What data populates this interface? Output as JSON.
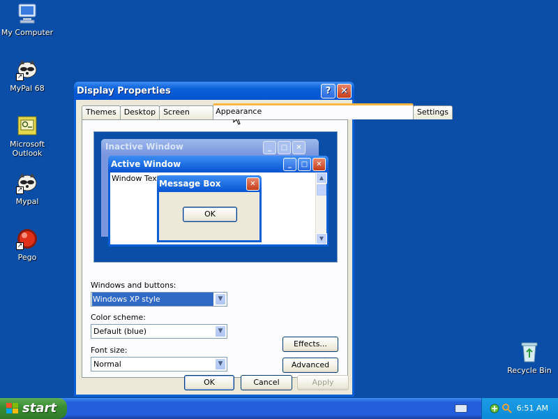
{
  "desktop": {
    "icons": [
      {
        "label": "My Computer"
      },
      {
        "label": "MyPal 68"
      },
      {
        "label": "Microsoft\nOutlook"
      },
      {
        "label": "Mypal"
      },
      {
        "label": "Pego"
      },
      {
        "label": "Recycle Bin"
      }
    ]
  },
  "dialog": {
    "title": "Display Properties",
    "help_glyph": "?",
    "close_glyph": "✕",
    "tabs": [
      "Themes",
      "Desktop",
      "Screen Saver",
      "Appearance",
      "Settings"
    ],
    "active_tab": "Appearance",
    "preview": {
      "inactive_title": "Inactive Window",
      "active_title": "Active Window",
      "window_text": "Window Text",
      "message_title": "Message Box",
      "ok_label": "OK"
    },
    "windows_buttons_label": "Windows and buttons:",
    "windows_buttons_value": "Windows XP style",
    "color_scheme_label": "Color scheme:",
    "color_scheme_value": "Default (blue)",
    "font_size_label": "Font size:",
    "font_size_value": "Normal",
    "effects_label": "Effects...",
    "advanced_label": "Advanced",
    "ok_label": "OK",
    "cancel_label": "Cancel",
    "apply_label": "Apply"
  },
  "taskbar": {
    "start_label": "start",
    "clock": "6:51 AM"
  },
  "colors": {
    "desktop": "#0b4ea8",
    "titlebar": "#0a5fd6",
    "dialog_face": "#ece9d8",
    "start_green": "#3c8f34",
    "selection": "#316ac5"
  }
}
